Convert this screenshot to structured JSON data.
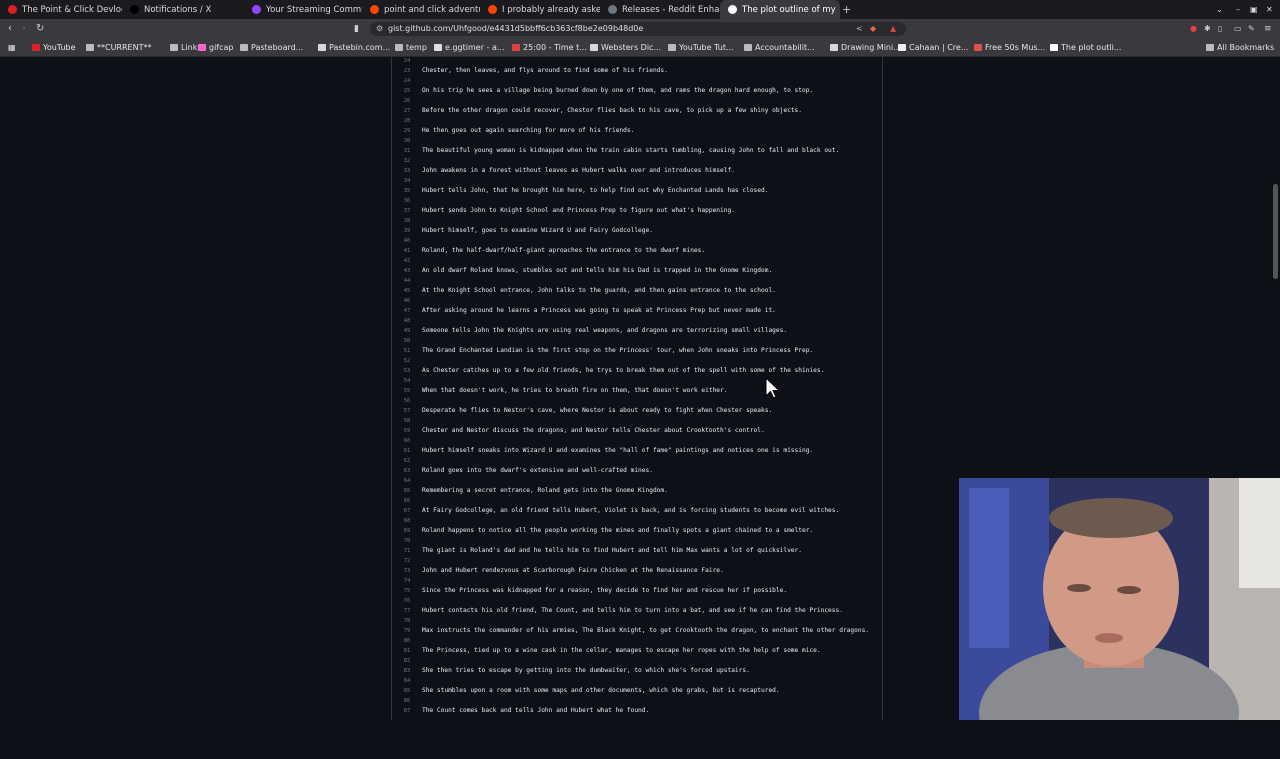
{
  "tabs": [
    {
      "label": "The Point & Click Devlog",
      "color": "#e02020"
    },
    {
      "label": "Notifications / X",
      "color": "#000000"
    },
    {
      "label": "Your Streaming Commun",
      "color": "#9146ff"
    },
    {
      "label": "point and click adventur",
      "color": "#ff4500"
    },
    {
      "label": "I probably already asked",
      "color": "#ff4500"
    },
    {
      "label": "Releases - Reddit Enhanc",
      "color": "#6e7681"
    },
    {
      "label": "The plot outline of my",
      "color": "#ffffff",
      "active": true
    }
  ],
  "address": {
    "url": "gist.github.com/Uhfgood/e4431d5bbff6cb363cf8be2e09b48d0e"
  },
  "bookmarks": [
    {
      "label": "YouTube",
      "icon": "youtube-icon",
      "color": "#e02020"
    },
    {
      "label": "**CURRENT**",
      "icon": "folder-icon",
      "color": "#bbbbbb"
    },
    {
      "label": "Links",
      "icon": "folder-icon",
      "color": "#bbbbbb"
    },
    {
      "label": "gifcap",
      "icon": "gifcap-icon",
      "color": "#ff66cc"
    },
    {
      "label": "Pasteboard...",
      "icon": "folder-icon",
      "color": "#bbbbbb"
    },
    {
      "label": "Pastebin.com...",
      "icon": "pastebin-icon",
      "color": "#d9d9d9"
    },
    {
      "label": "temp",
      "icon": "folder-icon",
      "color": "#bbbbbb"
    },
    {
      "label": "e.ggtimer - a...",
      "icon": "timer-icon",
      "color": "#e0e0e0"
    },
    {
      "label": "25:00 - Time t...",
      "icon": "tomato-icon",
      "color": "#e04040"
    },
    {
      "label": "Websters Dic...",
      "icon": "dictionary-icon",
      "color": "#d9d9d9"
    },
    {
      "label": "YouTube Tut...",
      "icon": "folder-icon",
      "color": "#bbbbbb"
    },
    {
      "label": "Accountabilit...",
      "icon": "folder-icon",
      "color": "#bbbbbb"
    },
    {
      "label": "Drawing Mini...",
      "icon": "page-icon",
      "color": "#d9d9d9"
    },
    {
      "label": "Cahaan | Cre...",
      "icon": "cahaan-icon",
      "color": "#eeeeee"
    },
    {
      "label": "Free 50s Mus...",
      "icon": "music-icon",
      "color": "#e05050"
    },
    {
      "label": "The plot outli...",
      "icon": "github-icon",
      "color": "#ffffff"
    }
  ],
  "all_bookmarks": "All Bookmarks",
  "gist_lines": [
    {
      "n": "24",
      "t": ""
    },
    {
      "n": "23",
      "t": "Chester, then leaves, and flys around to find some of his friends."
    },
    {
      "n": "24",
      "t": ""
    },
    {
      "n": "25",
      "t": "On his trip he sees a village being burned down by one of them, and rams the dragon hard enough, to stop."
    },
    {
      "n": "26",
      "t": ""
    },
    {
      "n": "27",
      "t": "Before the other dragon could recover, Chestor flies back to his cave, to pick up a few shiny objects."
    },
    {
      "n": "28",
      "t": ""
    },
    {
      "n": "29",
      "t": "He then goes out again searching for more of his friends."
    },
    {
      "n": "30",
      "t": ""
    },
    {
      "n": "31",
      "t": "The beautiful young woman is kidnapped when the train cabin starts tumbling, causing John to fall and black out."
    },
    {
      "n": "32",
      "t": ""
    },
    {
      "n": "33",
      "t": "John awakens in a forest without leaves as Hubert walks over and introduces himself."
    },
    {
      "n": "34",
      "t": ""
    },
    {
      "n": "35",
      "t": "Hubert tells John, that he brought him here, to help find out why Enchanted Lands has closed."
    },
    {
      "n": "36",
      "t": ""
    },
    {
      "n": "37",
      "t": "Hubert sends John to Knight School and Princess Prep to figure out what's happening."
    },
    {
      "n": "38",
      "t": ""
    },
    {
      "n": "39",
      "t": "Hubert himself, goes to examine Wizard U and Fairy Godcollege."
    },
    {
      "n": "40",
      "t": ""
    },
    {
      "n": "41",
      "t": "Roland, the half-dwarf/half-giant aproaches the entrance to the dwarf mines."
    },
    {
      "n": "42",
      "t": ""
    },
    {
      "n": "43",
      "t": "An old dwarf Roland knows, stumbles out and tells him his Dad is trapped in the Gnome Kingdom."
    },
    {
      "n": "44",
      "t": ""
    },
    {
      "n": "45",
      "t": "At the Knight School entrance, John talks to the guards, and then gains entrance to the school."
    },
    {
      "n": "46",
      "t": ""
    },
    {
      "n": "47",
      "t": "After asking around he learns a Princess was going to speak at Princess Prep but never made it."
    },
    {
      "n": "48",
      "t": ""
    },
    {
      "n": "49",
      "t": "Someone tells John the Knights are using real weapons, and dragons are terrorizing small villages."
    },
    {
      "n": "50",
      "t": ""
    },
    {
      "n": "51",
      "t": "The Grand Enchanted Landian is the first stop on the Princess' tour, when John sneaks into Princess Prep."
    },
    {
      "n": "52",
      "t": ""
    },
    {
      "n": "53",
      "t": "As Chester catches up to a few old friends, he trys to break them out of the spell with some of the shinies."
    },
    {
      "n": "54",
      "t": ""
    },
    {
      "n": "55",
      "t": "When that doesn't work, he tries to breath fire on them, that doesn't work either."
    },
    {
      "n": "56",
      "t": ""
    },
    {
      "n": "57",
      "t": "Desperate he flies to Nestor's cave, where Nestor is about ready to fight when Chester speaks."
    },
    {
      "n": "58",
      "t": ""
    },
    {
      "n": "59",
      "t": "Chester and Nestor discuss the dragons, and Nestor tells Chester about Crooktooth's control."
    },
    {
      "n": "60",
      "t": ""
    },
    {
      "n": "61",
      "t": "Hubert himself sneaks into Wizard U and examines the \"hall of fame\" paintings and notices one is missing."
    },
    {
      "n": "62",
      "t": ""
    },
    {
      "n": "63",
      "t": "Roland goes into the dwarf's extensive and well-crafted mines."
    },
    {
      "n": "64",
      "t": ""
    },
    {
      "n": "65",
      "t": "Remembering a secret entrance, Roland gets into the Gnome Kingdom."
    },
    {
      "n": "66",
      "t": ""
    },
    {
      "n": "67",
      "t": "At Fairy Godcollege, an old friend tells Hubert, Violet is back, and is forcing students to become evil witches."
    },
    {
      "n": "68",
      "t": ""
    },
    {
      "n": "69",
      "t": "Roland happens to notice all the people working the mines and finally spots a giant chained to a smelter."
    },
    {
      "n": "70",
      "t": ""
    },
    {
      "n": "71",
      "t": "The giant is Roland's dad and he tells him to find Hubert and tell him Max wants a lot of quicksilver."
    },
    {
      "n": "72",
      "t": ""
    },
    {
      "n": "73",
      "t": "John and Hubert rendezvous at Scarborough Faire Chicken at the Renaissance Faire."
    },
    {
      "n": "74",
      "t": ""
    },
    {
      "n": "75",
      "t": "Since the Princess was kidnapped for a reason, they decide to find her and rescue her if possible."
    },
    {
      "n": "76",
      "t": ""
    },
    {
      "n": "77",
      "t": "Hubert contacts his old friend, The Count, and tells him to turn into a bat, and see if he can find the Princess."
    },
    {
      "n": "78",
      "t": ""
    },
    {
      "n": "79",
      "t": "Max instructs the commander of his armies, The Black Knight, to get Crooktooth the dragon, to enchant the other dragons."
    },
    {
      "n": "80",
      "t": ""
    },
    {
      "n": "81",
      "t": "The Princess, tied up to a wine cask in the cellar, manages to escape her ropes with the help of some mice."
    },
    {
      "n": "82",
      "t": ""
    },
    {
      "n": "83",
      "t": "She then tries to escape by getting into the dumbwaiter, to which she's forced upstairs."
    },
    {
      "n": "84",
      "t": ""
    },
    {
      "n": "85",
      "t": "She stumbles upon a room with some maps and other documents, which she grabs, but is recaptured."
    },
    {
      "n": "86",
      "t": ""
    },
    {
      "n": "87",
      "t": "The Count comes back and tells John and Hubert what he found."
    }
  ]
}
